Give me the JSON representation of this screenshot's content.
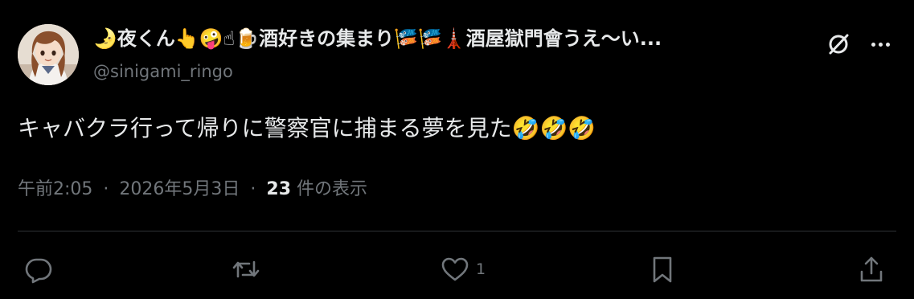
{
  "author": {
    "display_name": "🌛夜くん👆🤪☝🍺酒好きの集まり🎏🎏🗼酒屋獄門會うえ〜い...",
    "handle": "@sinigami_ringo"
  },
  "tweet": {
    "text": "キャバクラ行って帰りに警察官に捕まる夢を見た🤣🤣🤣"
  },
  "meta": {
    "time": "午前2:05",
    "separator": "·",
    "date": "2026年5月3日",
    "views_count": "23",
    "views_label": "件の表示"
  },
  "actions": {
    "reply_count": "",
    "retweet_count": "",
    "like_count": "1"
  },
  "colors": {
    "background": "#000000",
    "primary_text": "#e7e9ea",
    "secondary_text": "#71767b",
    "divider": "#2f3336"
  },
  "icons": [
    "grok-icon",
    "more-icon",
    "reply-icon",
    "retweet-icon",
    "like-icon",
    "bookmark-icon",
    "share-icon"
  ]
}
